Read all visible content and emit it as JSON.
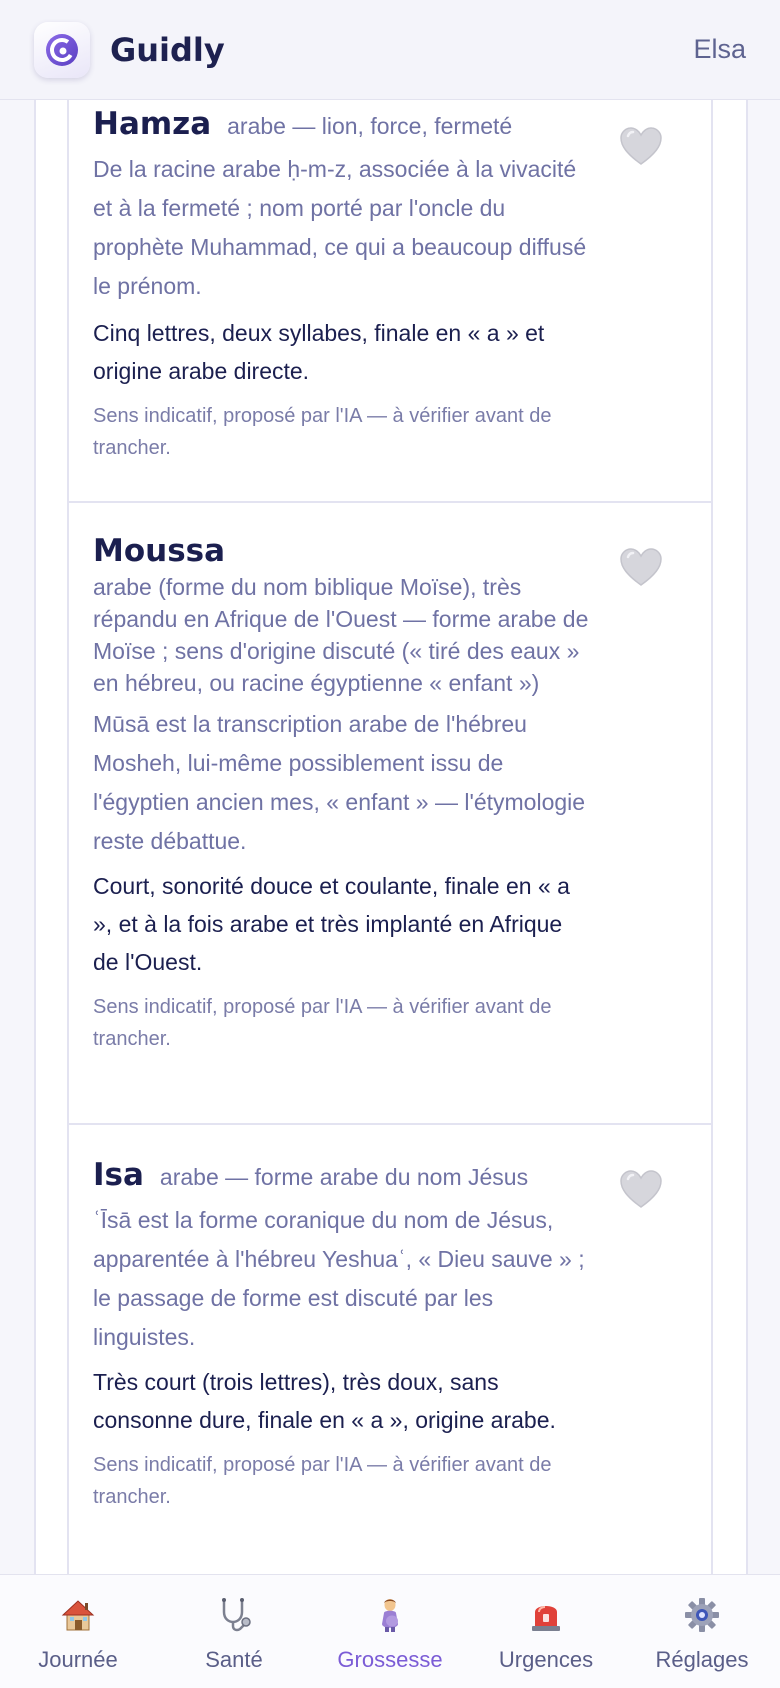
{
  "header": {
    "app_title": "Guidly",
    "user_name": "Elsa",
    "logo_letter": "G"
  },
  "names": [
    {
      "name": "Hamza",
      "origin": "arabe — lion, force, fermeté",
      "etymology": "De la racine arabe ḥ-m-z, associée à la vivacité et à la fermeté ; nom porté par l'oncle du prophète Muhammad, ce qui a beaucoup diffusé le prénom.",
      "why": "Cinq lettres, deux syllabes, finale en « a » et origine arabe directe.",
      "disclaimer": "Sens indicatif, proposé par l'IA — à vérifier avant de trancher.",
      "favorite": false
    },
    {
      "name": "Moussa",
      "origin": "arabe (forme du nom biblique Moïse), très répandu en Afrique de l'Ouest — forme arabe de Moïse ; sens d'origine discuté (« tiré des eaux » en hébreu, ou racine égyptienne « enfant »)",
      "etymology": "Mūsā est la transcription arabe de l'hébreu Mosheh, lui-même possiblement issu de l'égyptien ancien mes, « enfant » — l'étymologie reste débattue.",
      "why": "Court, sonorité douce et coulante, finale en « a », et à la fois arabe et très implanté en Afrique de l'Ouest.",
      "disclaimer": "Sens indicatif, proposé par l'IA — à vérifier avant de trancher.",
      "favorite": false
    },
    {
      "name": "Isa",
      "origin": "arabe — forme arabe du nom Jésus",
      "etymology": "ʿĪsā est la forme coranique du nom de Jésus, apparentée à l'hébreu Yeshuaʿ, « Dieu sauve » ; le passage de forme est discuté par les linguistes.",
      "why": "Très court (trois lettres), très doux, sans consonne dure, finale en « a », origine arabe.",
      "disclaimer": "Sens indicatif, proposé par l'IA — à vérifier avant de trancher.",
      "favorite": false
    }
  ],
  "tabbar": [
    {
      "label": "Journée",
      "icon": "house-icon",
      "active": false
    },
    {
      "label": "Santé",
      "icon": "stethoscope-icon",
      "active": false
    },
    {
      "label": "Grossesse",
      "icon": "pregnant-woman-icon",
      "active": true
    },
    {
      "label": "Urgences",
      "icon": "siren-icon",
      "active": false
    },
    {
      "label": "Réglages",
      "icon": "gear-icon",
      "active": false
    }
  ],
  "colors": {
    "accent": "#7b5cd6",
    "text_primary": "#1b1f4f",
    "text_secondary": "#6f72a4"
  }
}
